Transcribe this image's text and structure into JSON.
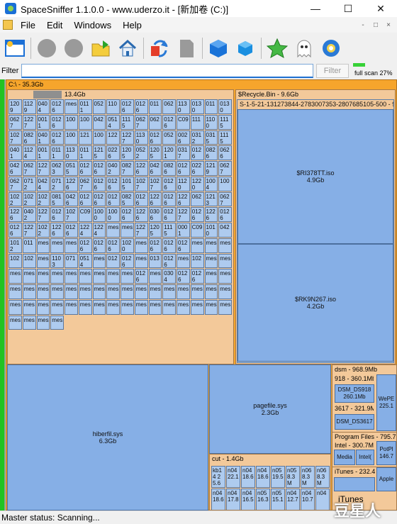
{
  "window": {
    "title": "SpaceSniffer 1.1.0.0 - www.uderzo.it - [新加卷 (C:)]",
    "minimize": "—",
    "maximize": "☐",
    "close": "✕"
  },
  "menu": {
    "items": [
      "File",
      "Edit",
      "Windows",
      "Help"
    ],
    "right_controls": [
      "-",
      "□",
      "×"
    ]
  },
  "toolbar": {
    "icons": [
      "new-window-icon",
      "stop-icon",
      "pause-icon",
      "open-folder-icon",
      "home-icon",
      "refresh-icon",
      "blank-icon",
      "zoom-in-cube-icon",
      "zoom-out-cube-icon",
      "star-icon",
      "ghost-icon",
      "settings-flower-icon"
    ]
  },
  "filter": {
    "label": "Filter",
    "value": "",
    "button": "Filter",
    "scan_text": "full scan 27%",
    "scan_progress": 0.27
  },
  "treemap": {
    "drive": "C:\\ - 35.3Gb",
    "folder1": "13.4Gb",
    "recycle": "$Recycle.Bin - 9.6Gb",
    "sid": "S-1-5-21-131273844-2783007353-2807685105-500 - 9.",
    "rtt": {
      "name": "$RI378TT.iso",
      "size": "4.9Gb"
    },
    "rk9": {
      "name": "$RK9N267.iso",
      "size": "4.2Gb"
    },
    "hiberfil": {
      "name": "hiberfil.sys",
      "size": "6.3Gb"
    },
    "pagefile": {
      "name": "pagefile.sys",
      "size": "2.3Gb"
    },
    "cut": "cut - 1.4Gb",
    "dsm": "dsm - 968.9Mb",
    "dsm_918": "918 - 360.1Mb",
    "dsm_file": "DSM_DS918 260.1Mb",
    "dsm_3617": "3617 - 321.9M",
    "dsm_file2": "DSM_DS3617",
    "wepe": "WePE 225.1",
    "program_files": "Program Files - 795.7",
    "intel": "Intel - 300.7M",
    "media": "Media",
    "intel2": "Intel(",
    "potp": "PotPl 146.7",
    "itunes_folder": "iTunes - 232.4",
    "apple": "Apple",
    "itunes_label": "iTunes",
    "cells": [
      "1209",
      "1129",
      "0404",
      "0126",
      "mes",
      "0111",
      "052",
      "110",
      "0126",
      "0126",
      "011",
      "062",
      "1130",
      "0130",
      "011",
      "0130",
      "0627",
      "1227",
      "0011",
      "0126",
      "100",
      "100",
      "042",
      "0514",
      "1115",
      "0627",
      "062",
      "0126",
      "C09",
      "111",
      "1100",
      "1115",
      "1027",
      "0826",
      "0401",
      "0126",
      "100",
      "121",
      "100",
      "122",
      "1227",
      "1130",
      "0126",
      "052",
      "0026",
      "0312",
      "0315",
      "1115",
      "0401",
      "1124",
      "0011",
      "0111",
      "1130",
      "0111",
      "1215",
      "0226",
      "1205",
      "0522",
      "1205",
      "1201",
      "0317",
      "0126",
      "0826",
      "0626",
      "0426",
      "0627",
      "1227",
      "0623",
      "0515",
      "0126",
      "0126",
      "0402",
      "0827",
      "1226",
      "0426",
      "0826",
      "0126",
      "0226",
      "1219",
      "0627",
      "0627",
      "0712",
      "0424",
      "0712",
      "1226",
      "0627",
      "0126",
      "0126",
      "1015",
      "1027",
      "1027",
      "0126",
      "1120",
      "1220",
      "1004",
      "100",
      "1022",
      "1022",
      "1022",
      "0815",
      "0426",
      "0126",
      "0126",
      "0126",
      "0825",
      "0126",
      "1226",
      "0126",
      "1226",
      "062",
      "1213",
      "0627",
      "1226",
      "0402",
      "1227",
      "0126",
      "1027",
      "C09",
      "1000",
      "1000",
      "0126",
      "1226",
      "0306",
      "0126",
      "1227",
      "0126",
      "1226",
      "0126",
      "0126",
      "1227",
      "1022",
      "1226",
      "0126",
      "1224",
      "1224",
      "mes",
      "mes",
      "1227",
      "1205",
      "1115",
      "0001",
      "C09",
      "1010",
      "042",
      "1012",
      "011",
      "mes",
      "mes",
      "mes",
      "0126",
      "0126",
      "0126",
      "1020",
      "mes",
      "0126",
      "0126",
      "0126",
      "mes",
      "mes",
      "mes",
      "102",
      "102",
      "mes",
      "1103",
      "071",
      "0514",
      "mes",
      "012",
      "0126",
      "mes",
      "013",
      "0126",
      "mes",
      "102",
      "mes",
      "mes",
      "mes",
      "mes",
      "mes",
      "mes",
      "mes",
      "mes",
      "mes",
      "mes",
      "mes",
      "0126",
      "mes",
      "0304",
      "0126",
      "0126",
      "mes",
      "mes",
      "mes",
      "mes",
      "mes",
      "mes",
      "mes",
      "mes",
      "mes",
      "mes",
      "mes",
      "mes",
      "mes",
      "mes",
      "mes",
      "mes",
      "mes",
      "mes",
      "mes",
      "mes",
      "mes",
      "mes",
      "mes",
      "mes",
      "mes",
      "mes",
      "mes",
      "mes",
      "mes",
      "mes",
      "mes",
      "mes",
      "mes",
      "mes",
      "mes",
      "mes",
      "mes",
      "mes"
    ],
    "cut_cells": [
      "kb14 25.6",
      "n04 22.1",
      "n04 18.6",
      "n04 18.6",
      "n05 19.5",
      "n05 8.3M",
      "n06 8.3M",
      "n06 8.3M",
      "n04 18.6",
      "n04 17.8",
      "n04 16.5",
      "n05 16.3",
      "n05 15.1",
      "n04 12.7",
      "n04 10.7",
      "n04"
    ]
  },
  "status": {
    "text": "Master status: Scanning..."
  },
  "watermark": "豆星人"
}
